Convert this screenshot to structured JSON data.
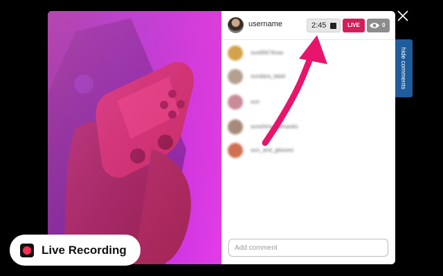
{
  "header": {
    "username": "username",
    "timer": "2:45",
    "live_label": "LIVE",
    "viewer_count": "0"
  },
  "comments": [
    {
      "name": "sunil5674row",
      "avatar_color": "#d4a24a"
    },
    {
      "name": "sundara_label",
      "avatar_color": "#b5a090"
    },
    {
      "name": "sun",
      "avatar_color": "#c98a9a"
    },
    {
      "name": "sunshine_offmanks",
      "avatar_color": "#a88a7a"
    },
    {
      "name": "sun_and_glasses",
      "avatar_color": "#d07050"
    }
  ],
  "comment_input": {
    "placeholder": "Add comment"
  },
  "side_tab": {
    "label": "hide comments"
  },
  "recording_badge": {
    "label": "Live Recording"
  },
  "colors": {
    "live": "#d41e5c",
    "arrow": "#e8156c",
    "tab": "#1e5c9c",
    "record_dot": "#ff2d55"
  },
  "icons": [
    "stop-icon",
    "eye-icon",
    "close-icon",
    "record-icon",
    "arrow-annotation"
  ]
}
